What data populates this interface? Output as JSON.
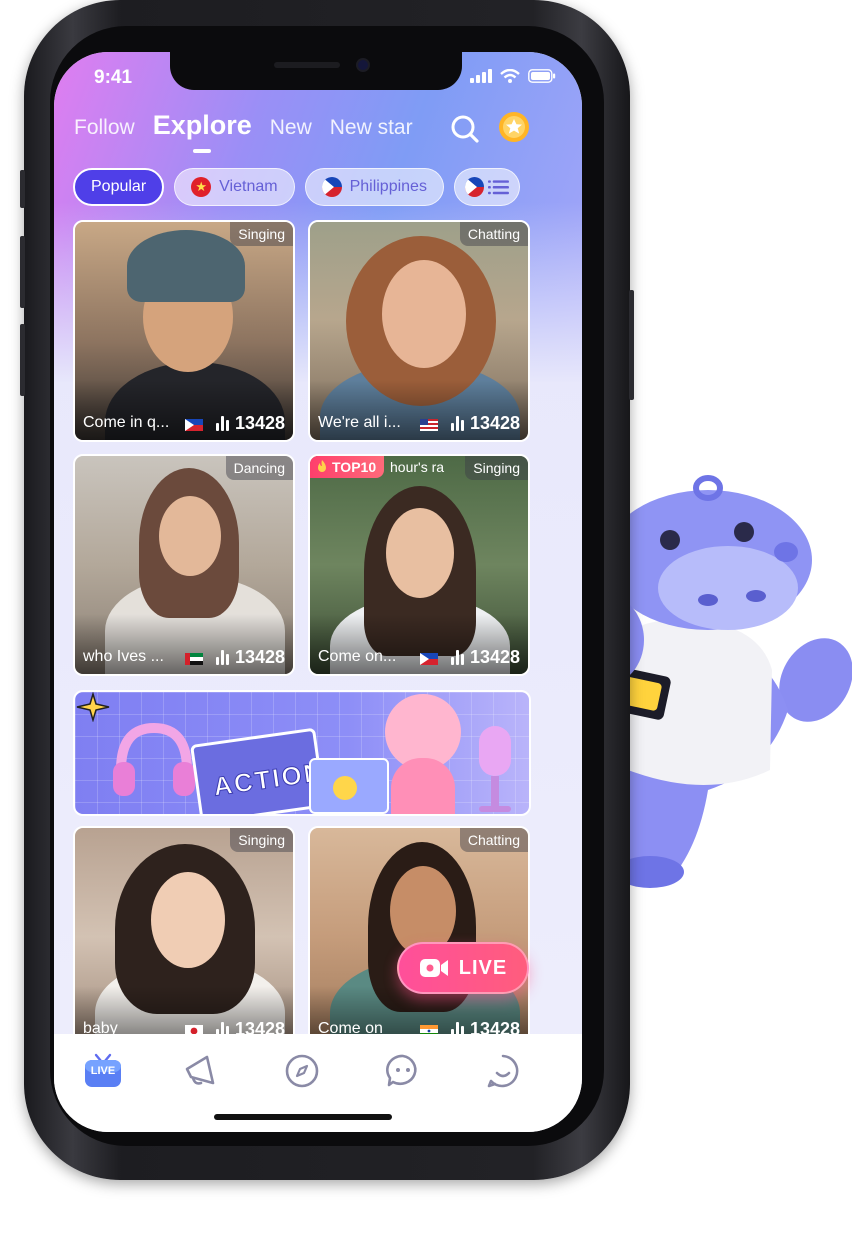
{
  "status_bar": {
    "time": "9:41"
  },
  "top_nav": {
    "tabs": [
      {
        "label": "Follow",
        "active": false
      },
      {
        "label": "Explore",
        "active": true
      },
      {
        "label": "New",
        "active": false
      },
      {
        "label": "New star",
        "active": false
      }
    ],
    "icons": [
      "search-icon",
      "trophy-icon"
    ]
  },
  "categories": [
    {
      "label": "Popular",
      "active": true
    },
    {
      "label": "Vietnam",
      "flag": "vietnam-flag"
    },
    {
      "label": "Philippines",
      "flag": "philippines-flag"
    }
  ],
  "rooms": [
    {
      "tag": "Singing",
      "caption": "Come in q...",
      "flag": "philippines-flag",
      "viewers": "13428"
    },
    {
      "tag": "Chatting",
      "caption": "We're all i...",
      "flag": "usa-flag",
      "viewers": "13428"
    },
    {
      "tag": "Dancing",
      "caption": "who Ives ...",
      "flag": "uae-flag",
      "viewers": "13428"
    },
    {
      "tag": "Singing",
      "caption": "Come on...",
      "flag": "philippines-flag",
      "viewers": "13428",
      "badge": "TOP10",
      "badge_sub": "hour's ra"
    },
    {
      "tag": "Singing",
      "caption": "baby",
      "flag": "japan-flag",
      "viewers": "13428"
    },
    {
      "tag": "Chatting",
      "caption": "Come on",
      "flag": "india-flag",
      "viewers": "13428"
    }
  ],
  "banner": {
    "text": "ACTION"
  },
  "live_button": {
    "label": "LIVE"
  },
  "tabbar": {
    "items": [
      {
        "name": "live-tab",
        "label": "LIVE",
        "active": true
      },
      {
        "name": "party-tab"
      },
      {
        "name": "discover-tab"
      },
      {
        "name": "messages-tab"
      },
      {
        "name": "me-tab"
      }
    ]
  },
  "colors": {
    "accent": "#4f3fe8",
    "live": "#ff4f9a",
    "chip_text": "#6560d6"
  }
}
